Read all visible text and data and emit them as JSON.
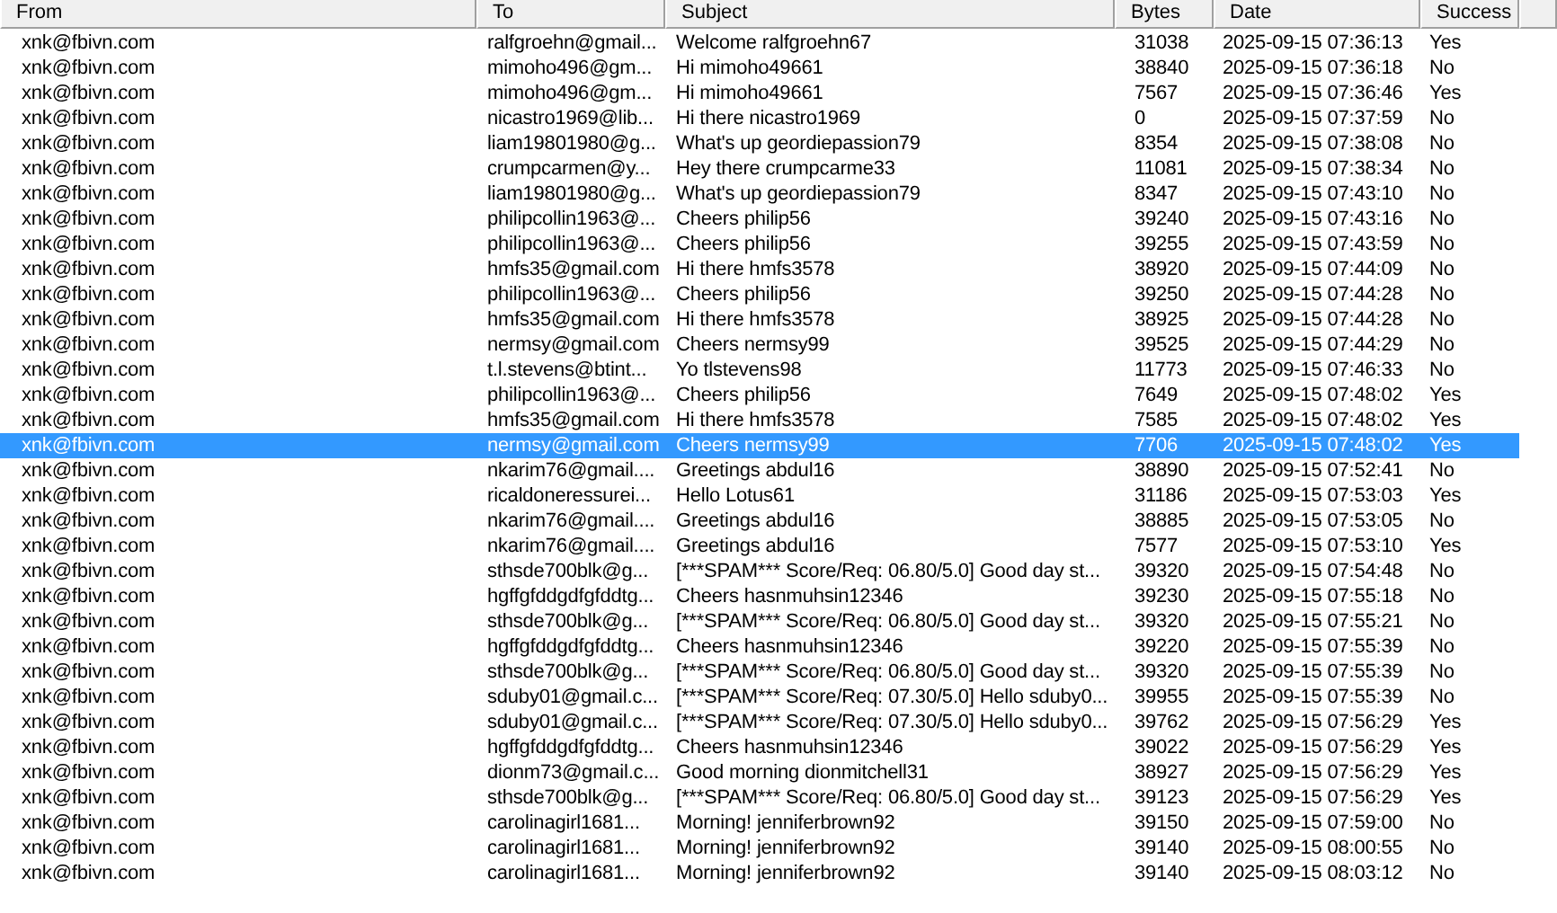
{
  "table": {
    "columns": [
      "From",
      "To",
      "Subject",
      "Bytes",
      "Date",
      "Success"
    ],
    "rows": [
      {
        "from": "xnk@fbivn.com",
        "to": "ralfgroehn@gmail...",
        "subject": "Welcome ralfgroehn67",
        "bytes": "31038",
        "date": "2025-09-15 07:36:13",
        "success": "Yes",
        "selected": false
      },
      {
        "from": "xnk@fbivn.com",
        "to": "mimoho496@gm...",
        "subject": "Hi mimoho49661",
        "bytes": "38840",
        "date": "2025-09-15 07:36:18",
        "success": "No",
        "selected": false
      },
      {
        "from": "xnk@fbivn.com",
        "to": "mimoho496@gm...",
        "subject": "Hi mimoho49661",
        "bytes": "7567",
        "date": "2025-09-15 07:36:46",
        "success": "Yes",
        "selected": false
      },
      {
        "from": "xnk@fbivn.com",
        "to": "nicastro1969@lib...",
        "subject": "Hi there nicastro1969",
        "bytes": "0",
        "date": "2025-09-15 07:37:59",
        "success": "No",
        "selected": false
      },
      {
        "from": "xnk@fbivn.com",
        "to": "liam19801980@g...",
        "subject": "What's up geordiepassion79",
        "bytes": "8354",
        "date": "2025-09-15 07:38:08",
        "success": "No",
        "selected": false
      },
      {
        "from": "xnk@fbivn.com",
        "to": "crumpcarmen@y...",
        "subject": "Hey there crumpcarme33",
        "bytes": "11081",
        "date": "2025-09-15 07:38:34",
        "success": "No",
        "selected": false
      },
      {
        "from": "xnk@fbivn.com",
        "to": "liam19801980@g...",
        "subject": "What's up geordiepassion79",
        "bytes": "8347",
        "date": "2025-09-15 07:43:10",
        "success": "No",
        "selected": false
      },
      {
        "from": "xnk@fbivn.com",
        "to": "philipcollin1963@...",
        "subject": "Cheers philip56",
        "bytes": "39240",
        "date": "2025-09-15 07:43:16",
        "success": "No",
        "selected": false
      },
      {
        "from": "xnk@fbivn.com",
        "to": "philipcollin1963@...",
        "subject": "Cheers philip56",
        "bytes": "39255",
        "date": "2025-09-15 07:43:59",
        "success": "No",
        "selected": false
      },
      {
        "from": "xnk@fbivn.com",
        "to": "hmfs35@gmail.com",
        "subject": "Hi there hmfs3578",
        "bytes": "38920",
        "date": "2025-09-15 07:44:09",
        "success": "No",
        "selected": false
      },
      {
        "from": "xnk@fbivn.com",
        "to": "philipcollin1963@...",
        "subject": "Cheers philip56",
        "bytes": "39250",
        "date": "2025-09-15 07:44:28",
        "success": "No",
        "selected": false
      },
      {
        "from": "xnk@fbivn.com",
        "to": "hmfs35@gmail.com",
        "subject": "Hi there hmfs3578",
        "bytes": "38925",
        "date": "2025-09-15 07:44:28",
        "success": "No",
        "selected": false
      },
      {
        "from": "xnk@fbivn.com",
        "to": "nermsy@gmail.com",
        "subject": "Cheers nermsy99",
        "bytes": "39525",
        "date": "2025-09-15 07:44:29",
        "success": "No",
        "selected": false
      },
      {
        "from": "xnk@fbivn.com",
        "to": "t.l.stevens@btint...",
        "subject": "Yo tlstevens98",
        "bytes": "11773",
        "date": "2025-09-15 07:46:33",
        "success": "No",
        "selected": false
      },
      {
        "from": "xnk@fbivn.com",
        "to": "philipcollin1963@...",
        "subject": "Cheers philip56",
        "bytes": "7649",
        "date": "2025-09-15 07:48:02",
        "success": "Yes",
        "selected": false
      },
      {
        "from": "xnk@fbivn.com",
        "to": "hmfs35@gmail.com",
        "subject": "Hi there hmfs3578",
        "bytes": "7585",
        "date": "2025-09-15 07:48:02",
        "success": "Yes",
        "selected": false
      },
      {
        "from": "xnk@fbivn.com",
        "to": "nermsy@gmail.com",
        "subject": "Cheers nermsy99",
        "bytes": "7706",
        "date": "2025-09-15 07:48:02",
        "success": "Yes",
        "selected": true
      },
      {
        "from": "xnk@fbivn.com",
        "to": "nkarim76@gmail....",
        "subject": "Greetings abdul16",
        "bytes": "38890",
        "date": "2025-09-15 07:52:41",
        "success": "No",
        "selected": false
      },
      {
        "from": "xnk@fbivn.com",
        "to": "ricaldoneressurei...",
        "subject": "Hello Lotus61",
        "bytes": "31186",
        "date": "2025-09-15 07:53:03",
        "success": "Yes",
        "selected": false
      },
      {
        "from": "xnk@fbivn.com",
        "to": "nkarim76@gmail....",
        "subject": "Greetings abdul16",
        "bytes": "38885",
        "date": "2025-09-15 07:53:05",
        "success": "No",
        "selected": false
      },
      {
        "from": "xnk@fbivn.com",
        "to": "nkarim76@gmail....",
        "subject": "Greetings abdul16",
        "bytes": "7577",
        "date": "2025-09-15 07:53:10",
        "success": "Yes",
        "selected": false
      },
      {
        "from": "xnk@fbivn.com",
        "to": "sthsde700blk@g...",
        "subject": "[***SPAM*** Score/Req: 06.80/5.0] Good day st...",
        "bytes": "39320",
        "date": "2025-09-15 07:54:48",
        "success": "No",
        "selected": false
      },
      {
        "from": "xnk@fbivn.com",
        "to": "hgffgfddgdfgfddtg...",
        "subject": "Cheers hasnmuhsin12346",
        "bytes": "39230",
        "date": "2025-09-15 07:55:18",
        "success": "No",
        "selected": false
      },
      {
        "from": "xnk@fbivn.com",
        "to": "sthsde700blk@g...",
        "subject": "[***SPAM*** Score/Req: 06.80/5.0] Good day st...",
        "bytes": "39320",
        "date": "2025-09-15 07:55:21",
        "success": "No",
        "selected": false
      },
      {
        "from": "xnk@fbivn.com",
        "to": "hgffgfddgdfgfddtg...",
        "subject": "Cheers hasnmuhsin12346",
        "bytes": "39220",
        "date": "2025-09-15 07:55:39",
        "success": "No",
        "selected": false
      },
      {
        "from": "xnk@fbivn.com",
        "to": "sthsde700blk@g...",
        "subject": "[***SPAM*** Score/Req: 06.80/5.0] Good day st...",
        "bytes": "39320",
        "date": "2025-09-15 07:55:39",
        "success": "No",
        "selected": false
      },
      {
        "from": "xnk@fbivn.com",
        "to": "sduby01@gmail.c...",
        "subject": "[***SPAM*** Score/Req: 07.30/5.0] Hello sduby0...",
        "bytes": "39955",
        "date": "2025-09-15 07:55:39",
        "success": "No",
        "selected": false
      },
      {
        "from": "xnk@fbivn.com",
        "to": "sduby01@gmail.c...",
        "subject": "[***SPAM*** Score/Req: 07.30/5.0] Hello sduby0...",
        "bytes": "39762",
        "date": "2025-09-15 07:56:29",
        "success": "Yes",
        "selected": false
      },
      {
        "from": "xnk@fbivn.com",
        "to": "hgffgfddgdfgfddtg...",
        "subject": "Cheers hasnmuhsin12346",
        "bytes": "39022",
        "date": "2025-09-15 07:56:29",
        "success": "Yes",
        "selected": false
      },
      {
        "from": "xnk@fbivn.com",
        "to": "dionm73@gmail.c...",
        "subject": "Good morning dionmitchell31",
        "bytes": "38927",
        "date": "2025-09-15 07:56:29",
        "success": "Yes",
        "selected": false
      },
      {
        "from": "xnk@fbivn.com",
        "to": "sthsde700blk@g...",
        "subject": "[***SPAM*** Score/Req: 06.80/5.0] Good day st...",
        "bytes": "39123",
        "date": "2025-09-15 07:56:29",
        "success": "Yes",
        "selected": false
      },
      {
        "from": "xnk@fbivn.com",
        "to": "carolinagirl1681...",
        "subject": "Morning! jenniferbrown92",
        "bytes": "39150",
        "date": "2025-09-15 07:59:00",
        "success": "No",
        "selected": false
      },
      {
        "from": "xnk@fbivn.com",
        "to": "carolinagirl1681...",
        "subject": "Morning! jenniferbrown92",
        "bytes": "39140",
        "date": "2025-09-15 08:00:55",
        "success": "No",
        "selected": false
      },
      {
        "from": "xnk@fbivn.com",
        "to": "carolinagirl1681...",
        "subject": "Morning! jenniferbrown92",
        "bytes": "39140",
        "date": "2025-09-15 08:03:12",
        "success": "No",
        "selected": false
      }
    ]
  }
}
